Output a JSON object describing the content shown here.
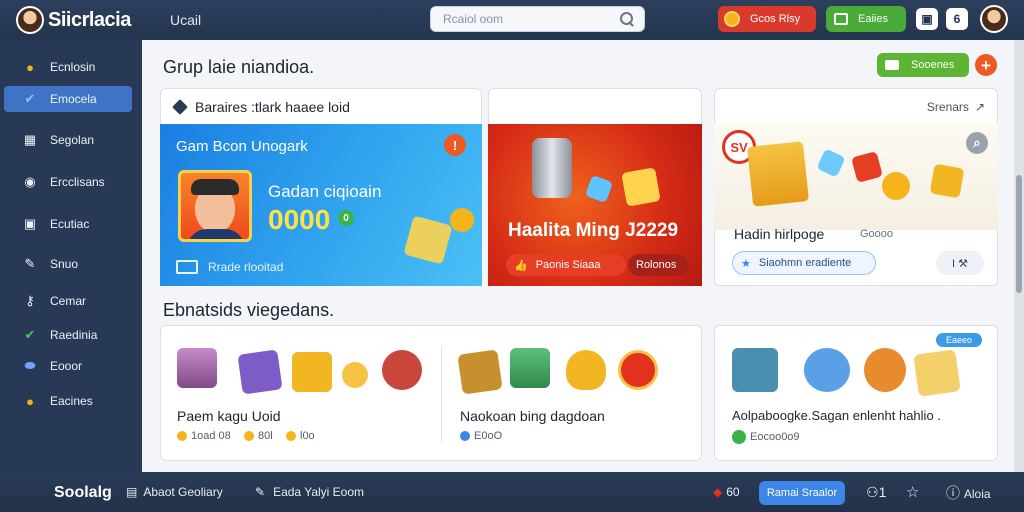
{
  "topbar": {
    "app_title": "Siicrlacia",
    "nav_link": "Ucail",
    "search_placeholder": "Rcaiol oom",
    "red_button": "Gcos Rlsy",
    "green_button": "Eaiies",
    "icon_badge": "6"
  },
  "sidebar": {
    "items": [
      {
        "label": "Ecnlosin",
        "icon": "coin-icon"
      },
      {
        "label": "Emocela",
        "icon": "twitter-bird-icon"
      },
      {
        "label": "Segolan",
        "icon": "calendar-icon"
      },
      {
        "label": "Ercclisans",
        "icon": "chat-icon"
      },
      {
        "label": "Ecutiac",
        "icon": "image-icon"
      },
      {
        "label": "Snuo",
        "icon": "pen-icon"
      },
      {
        "label": "Cemar",
        "icon": "key-icon"
      },
      {
        "label": "Raedinia",
        "icon": "check-icon"
      },
      {
        "label": "Eooor",
        "icon": "capsule-icon"
      },
      {
        "label": "Eacines",
        "icon": "gold-coin-icon"
      }
    ]
  },
  "main": {
    "section1_title": "Grup laie niandioa.",
    "add_button": "Sooenes",
    "card1": {
      "header": "Baraires :tlark haaee loid",
      "banner_title": "Gam Bcon Unogark",
      "promo_title": "Gadan ciqioain",
      "promo_value": "0000",
      "badge_small": "0",
      "footer_text": "Rrade rlooitad"
    },
    "card2": {
      "banner_title": "Haalita Ming J2229",
      "button_label": "Paonis Siaaa",
      "button_secondary": "Rolonos"
    },
    "card3": {
      "header": "Srenars",
      "banner_title": "Hadin hirlpoge",
      "sub_text": "Goooo",
      "action_label": "Siaohmn eradiente",
      "sticker": "SV"
    },
    "section2_title": "Ebnatsids viegedans.",
    "bottom_cards": [
      {
        "label": "Paem kagu Uoid",
        "stats": [
          "1oad 08",
          "80l",
          "l0o"
        ]
      },
      {
        "label": "Naokoan bing dagdoan",
        "stats": [
          "E0oO"
        ]
      },
      {
        "label": "Aolpaboogke.Sagan enlenht hahlio .",
        "stats": [
          "Eocoo0o9"
        ],
        "tag": "Eaeeo"
      }
    ]
  },
  "bottombar": {
    "username": "Soolalg",
    "item1": "Abaot Geoliary",
    "item2": "Eada Yalyi Eoom",
    "badge_value": "60",
    "primary_button": "Ramai Sraalor",
    "count1": "1",
    "last_label": "Aloia"
  },
  "colors": {
    "topbar": "#2c3f5c",
    "sidebar": "#273955",
    "accent_blue": "#3f73c5",
    "accent_red": "#d93a2c",
    "accent_green": "#4aab38",
    "accent_orange": "#ee5a24"
  }
}
